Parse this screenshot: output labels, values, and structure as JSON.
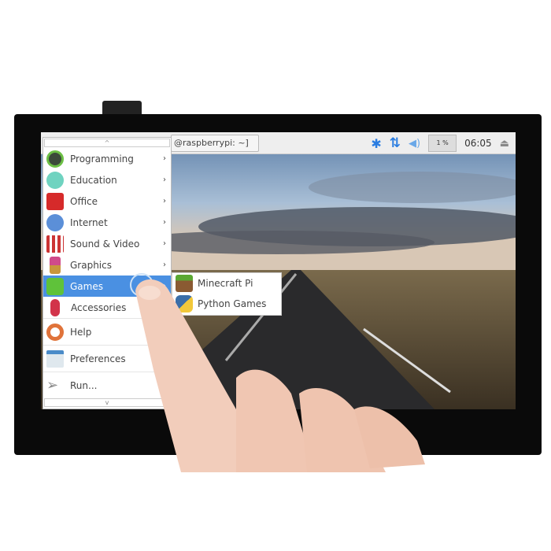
{
  "taskbar": {
    "window_button": "@raspberrypi: ~]",
    "cpu": "1 %",
    "clock": "06:05",
    "icons": [
      "bluetooth-icon",
      "network-icon",
      "volume-icon",
      "cpu-monitor",
      "eject-icon"
    ]
  },
  "menu": {
    "scroll_up": "^",
    "scroll_down": "v",
    "items": [
      {
        "label": "Programming",
        "icon": "programming-icon",
        "arrow": "›"
      },
      {
        "label": "Education",
        "icon": "education-icon",
        "arrow": "›"
      },
      {
        "label": "Office",
        "icon": "office-icon",
        "arrow": "›"
      },
      {
        "label": "Internet",
        "icon": "internet-icon",
        "arrow": "›"
      },
      {
        "label": "Sound & Video",
        "icon": "sound-video-icon",
        "arrow": "›"
      },
      {
        "label": "Graphics",
        "icon": "graphics-icon",
        "arrow": "›"
      },
      {
        "label": "Games",
        "icon": "games-icon",
        "arrow": "›",
        "selected": true
      },
      {
        "label": "Accessories",
        "icon": "accessories-icon",
        "arrow": "›"
      },
      {
        "label": "Help",
        "icon": "help-icon"
      },
      {
        "label": "Preferences",
        "icon": "preferences-icon"
      },
      {
        "label": "Run...",
        "icon": "run-icon"
      }
    ]
  },
  "submenu": {
    "items": [
      {
        "label": "Minecraft Pi",
        "icon": "minecraft-icon"
      },
      {
        "label": "Python Games",
        "icon": "python-icon"
      }
    ]
  },
  "colors": {
    "highlight": "#4a90e2",
    "accent": "#2a7de1"
  }
}
